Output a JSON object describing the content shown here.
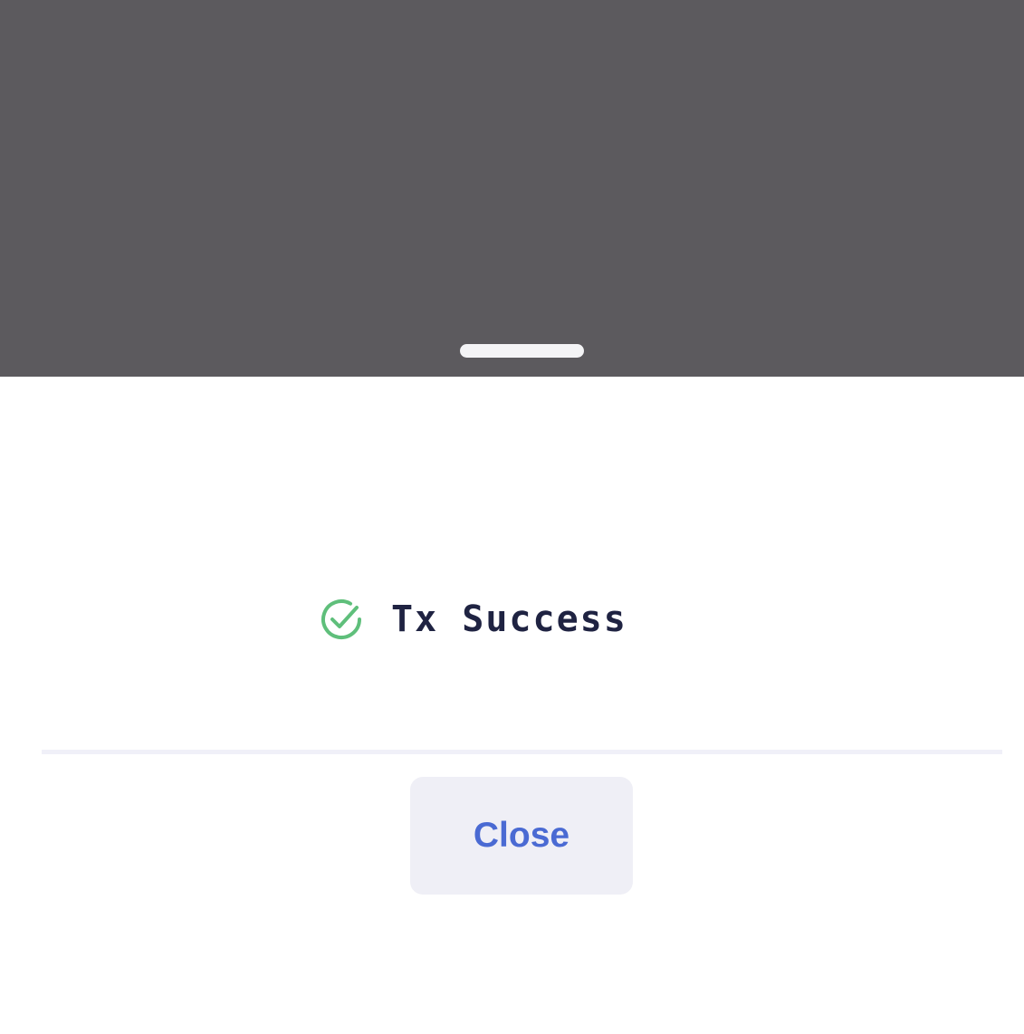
{
  "sheet": {
    "status": {
      "icon": "check-circle-icon",
      "text": "Tx Success",
      "color": "#5fbf7b"
    },
    "close_label": "Close"
  },
  "colors": {
    "overlay": "#5c5a5e",
    "title": "#1f2342",
    "button_bg": "#efeff6",
    "button_text": "#4a6ad3"
  }
}
